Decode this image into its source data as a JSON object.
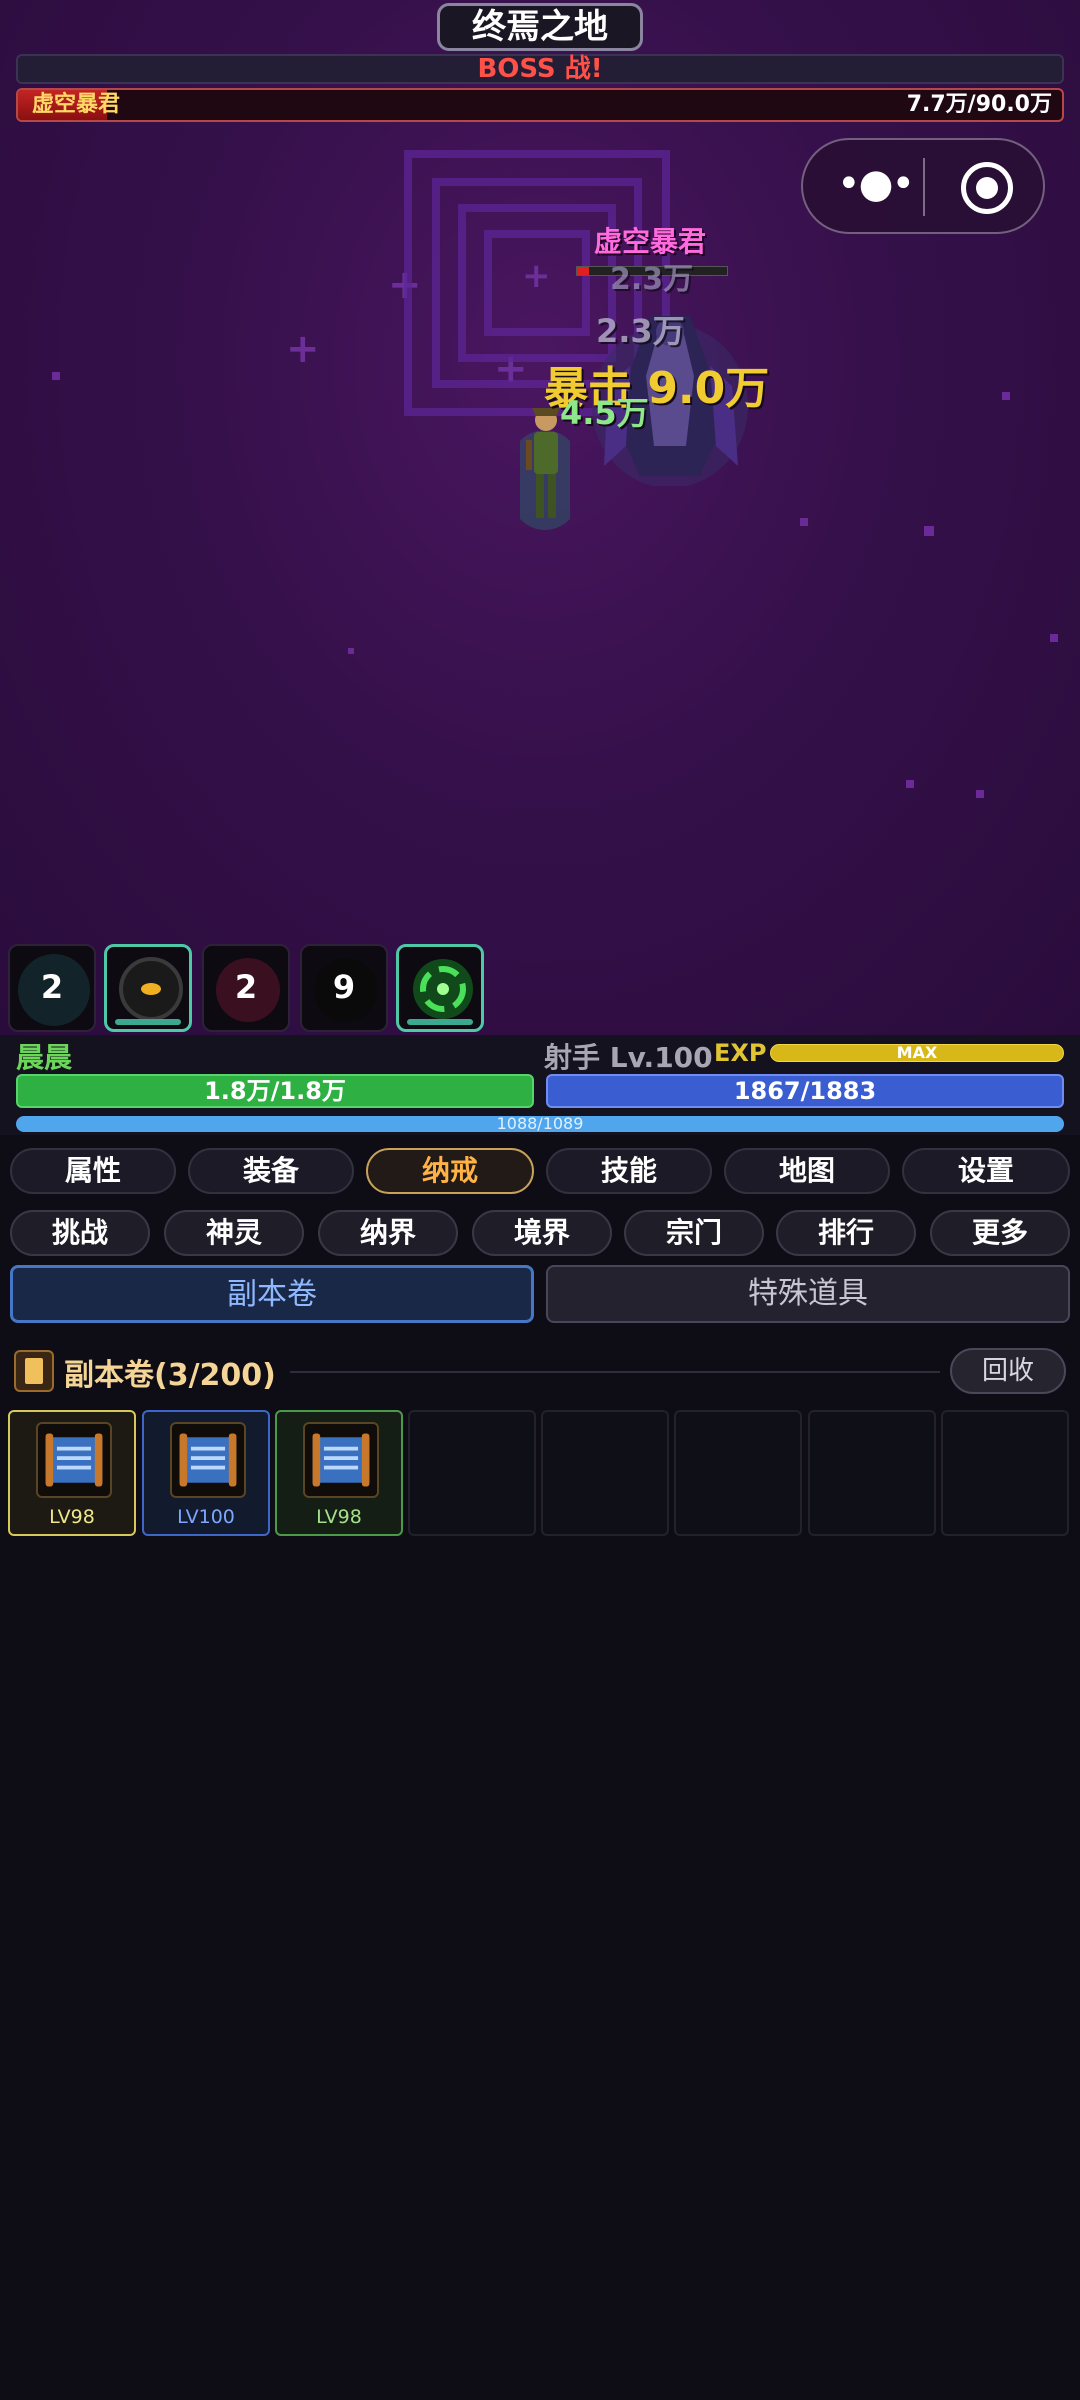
{
  "scene": {
    "title": "终焉之地",
    "boss_banner": "BOSS 战!",
    "boss_hp": {
      "name": "虚空暴君",
      "value": "7.7万/90.0万",
      "fraction": 0.0856
    },
    "enemy_name": "虚空暴君",
    "enemy_hp_fraction": 0.08,
    "damage_texts": [
      "2.3万",
      "2.3万",
      "暴击 9.0万",
      "4.5万"
    ]
  },
  "skills": [
    {
      "count": "2",
      "active": false
    },
    {
      "count": "",
      "active": true
    },
    {
      "count": "2",
      "active": false
    },
    {
      "count": "9",
      "active": false
    },
    {
      "count": "",
      "active": true
    }
  ],
  "player": {
    "name": "晨晨",
    "class_level": "射手 Lv.100",
    "exp_label": "EXP",
    "exp_text": "MAX",
    "hp": "1.8万/1.8万",
    "mp": "1867/1883",
    "third_bar": "1088/1089"
  },
  "main_tabs": [
    "属性",
    "装备",
    "纳戒",
    "技能",
    "地图",
    "设置"
  ],
  "main_tab_selected": "纳戒",
  "sub_tabs": [
    "挑战",
    "神灵",
    "纳界",
    "境界",
    "宗门",
    "排行",
    "更多"
  ],
  "panel_tabs": [
    "副本卷",
    "特殊道具"
  ],
  "section": {
    "title": "副本卷(3/200)",
    "recycle_label": "回收"
  },
  "inventory": [
    {
      "level": "LV98",
      "color": "#f0e68c"
    },
    {
      "level": "LV100",
      "color": "#7ea6ff"
    },
    {
      "level": "LV98",
      "color": "#a4e08c"
    }
  ],
  "colors": {
    "accent": "#ffb347",
    "hp": "#2fb043",
    "mp": "#3a5ed2",
    "boss": "#ff5148"
  }
}
